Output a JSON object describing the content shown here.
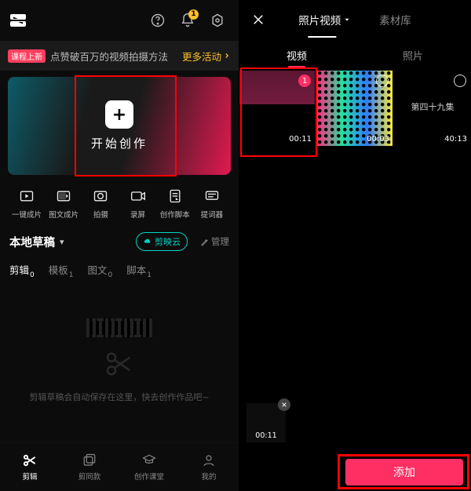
{
  "left": {
    "logo_icon": "capcut-icon",
    "header_icons": {
      "help": "help-icon",
      "bell": "bell-icon",
      "bell_badge": "1",
      "gear": "gear-icon"
    },
    "promo": {
      "tag": "课程上新",
      "text": "点赞破百万的视频拍摄方法",
      "more": "更多活动"
    },
    "hero": {
      "plus": "+",
      "label": "开始创作"
    },
    "tools": [
      {
        "label": "一键成片",
        "icon": "play-outline-icon"
      },
      {
        "label": "图文成片",
        "icon": "text-frame-icon"
      },
      {
        "label": "拍摄",
        "icon": "camera-icon"
      },
      {
        "label": "录屏",
        "icon": "screen-record-icon"
      },
      {
        "label": "创作脚本",
        "icon": "script-icon"
      },
      {
        "label": "提词器",
        "icon": "teleprompt-icon"
      }
    ],
    "drafts": {
      "title": "本地草稿",
      "cloud": "剪映云",
      "manage": "管理"
    },
    "draft_tabs": [
      {
        "label": "剪辑",
        "count": "0",
        "active": true
      },
      {
        "label": "模板",
        "count": "1"
      },
      {
        "label": "图文",
        "count": "0"
      },
      {
        "label": "脚本",
        "count": "1"
      }
    ],
    "empty_text": "剪辑草稿会自动保存在这里，快去创作作品吧~",
    "bottom_nav": [
      {
        "label": "剪辑",
        "icon": "scissors-icon",
        "active": true
      },
      {
        "label": "剪同款",
        "icon": "templates-icon"
      },
      {
        "label": "创作课堂",
        "icon": "academy-icon"
      },
      {
        "label": "我的",
        "icon": "profile-icon"
      }
    ]
  },
  "right": {
    "close_icon": "close-icon",
    "top_tabs": [
      {
        "label": "照片视频",
        "active": true,
        "chev": true
      },
      {
        "label": "素材库"
      }
    ],
    "sub_tabs": [
      {
        "label": "视频",
        "active": true
      },
      {
        "label": "照片"
      }
    ],
    "thumbs": [
      {
        "duration": "00:11",
        "selected": true,
        "sel_num": "1"
      },
      {
        "duration": "00:03"
      },
      {
        "duration": "40:13",
        "episode": "第四十九集"
      }
    ],
    "tray": {
      "chip_duration": "00:11"
    },
    "add_label": "添加"
  }
}
